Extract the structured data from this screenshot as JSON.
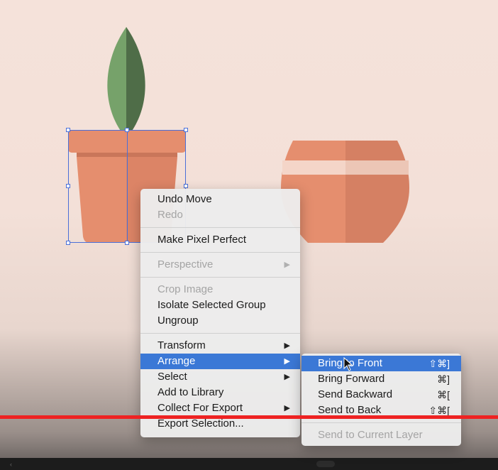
{
  "context_menu": {
    "items": [
      {
        "label": "Undo Move",
        "enabled": true
      },
      {
        "label": "Redo",
        "enabled": false
      },
      {
        "label": "Make Pixel Perfect",
        "enabled": true
      },
      {
        "label": "Perspective",
        "enabled": false,
        "submenu": true
      },
      {
        "label": "Crop Image",
        "enabled": false
      },
      {
        "label": "Isolate Selected Group",
        "enabled": true
      },
      {
        "label": "Ungroup",
        "enabled": true
      },
      {
        "label": "Transform",
        "enabled": true,
        "submenu": true
      },
      {
        "label": "Arrange",
        "enabled": true,
        "submenu": true,
        "highlighted": true
      },
      {
        "label": "Select",
        "enabled": true,
        "submenu": true
      },
      {
        "label": "Add to Library",
        "enabled": true
      },
      {
        "label": "Collect For Export",
        "enabled": true,
        "submenu": true
      },
      {
        "label": "Export Selection...",
        "enabled": true
      }
    ],
    "submenu_arrow": "▶"
  },
  "arrange_submenu": {
    "items": [
      {
        "label": "Bring to Front",
        "shortcut": "⇧⌘]",
        "highlighted": true
      },
      {
        "label": "Bring Forward",
        "shortcut": "⌘]"
      },
      {
        "label": "Send Backward",
        "shortcut": "⌘["
      },
      {
        "label": "Send to Back",
        "shortcut": "⇧⌘["
      },
      {
        "label": "Send to Current Layer",
        "shortcut": "",
        "enabled": false
      }
    ]
  },
  "colors": {
    "accent": "#3b78d6",
    "pot": "#e58e6e",
    "pot_shade": "#d07a5d",
    "leaf_light": "#76a26a",
    "leaf_dark": "#4f6d48",
    "selection": "#4a6fd8",
    "progress": "#ee2222"
  },
  "icons": {
    "cursor": "arrow-cursor-icon",
    "video_control": "chevron-left-icon"
  }
}
